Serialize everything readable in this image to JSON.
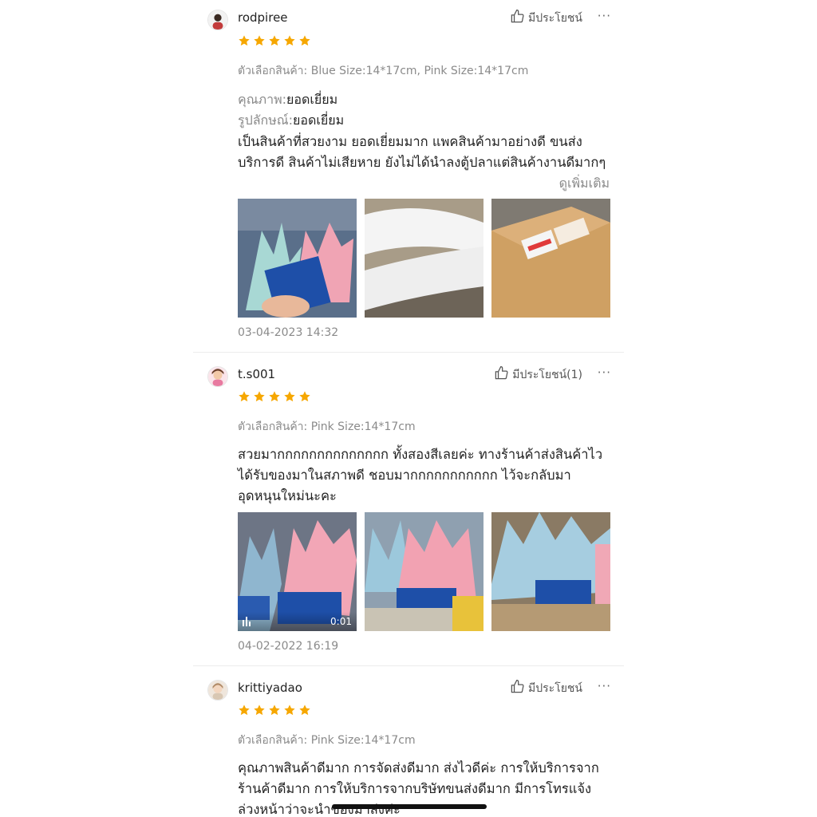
{
  "labels": {
    "helpful": "มีประโยชน์",
    "more": "···",
    "see_more": "ดูเพิ่มเติม"
  },
  "colors": {
    "star": "#f6a700",
    "text_muted": "#8a8a8a"
  },
  "icons": {
    "helpful": "thumbs-up-icon",
    "more": "more-dots-icon",
    "star": "star-icon"
  },
  "reviews": [
    {
      "username": "rodpiree",
      "rating": 5,
      "helpful_label": "มีประโยชน์",
      "variant": "ตัวเลือกสินค้า: Blue Size:14*17cm, Pink Size:14*17cm",
      "quality_key": "คุณภาพ:",
      "quality_value": "ยอดเยี่ยม",
      "look_key": "รูปลักษณ์:",
      "look_value": "ยอดเยี่ยม",
      "text": "เป็นสินค้าที่สวยงาม ยอดเยี่ยมมาก แพคสินค้ามาอย่างดี ขนส่งบริการดี สินค้าไม่เสียหาย ยังไม่ได้นำลงตู้ปลาแต่สินค้างานดีมากๆ",
      "date": "03-04-2023 14:32"
    },
    {
      "username": "t.s001",
      "rating": 5,
      "helpful_label": "มีประโยชน์(1)",
      "variant": "ตัวเลือกสินค้า: Pink Size:14*17cm",
      "text": "สวยมากกกกกกกกกกกกกก ทั้งสองสีเลยค่ะ ทางร้านค้าส่งสินค้าไวได้รับของมาในสภาพดี ชอบมากกกกกกกกกกก ไว้จะกลับมาอุดหนุนใหม่นะคะ",
      "video_duration": "0:01",
      "date": "04-02-2022 16:19"
    },
    {
      "username": "krittiyadao",
      "rating": 5,
      "helpful_label": "มีประโยชน์",
      "variant": "ตัวเลือกสินค้า: Pink Size:14*17cm",
      "text": "คุณภาพสินค้าดีมาก การจัดส่งดีมาก ส่งไวดีค่ะ การให้บริการจากร้านค้าดีมาก การให้บริการจากบริษัทขนส่งดีมาก มีการโทรแจ้งล่วงหน้าว่าจะนำของมาส่งค่ะ"
    }
  ]
}
